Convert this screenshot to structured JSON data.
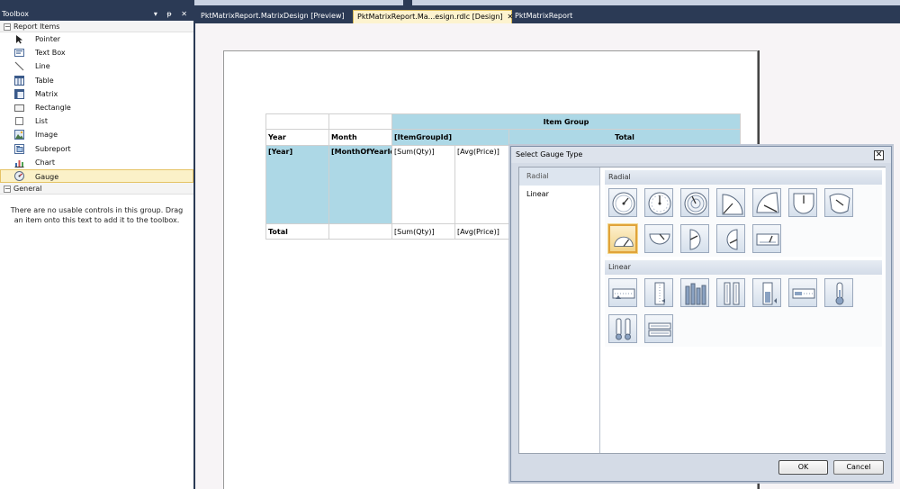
{
  "toolbox": {
    "title": "Toolbox",
    "controls": "▾ ᵽ ✕",
    "group_report_items": "Report Items",
    "items": [
      {
        "label": "Pointer",
        "icon": "pointer-icon"
      },
      {
        "label": "Text Box",
        "icon": "textbox-icon"
      },
      {
        "label": "Line",
        "icon": "line-icon"
      },
      {
        "label": "Table",
        "icon": "table-icon"
      },
      {
        "label": "Matrix",
        "icon": "matrix-icon"
      },
      {
        "label": "Rectangle",
        "icon": "rectangle-icon"
      },
      {
        "label": "List",
        "icon": "list-icon"
      },
      {
        "label": "Image",
        "icon": "image-icon"
      },
      {
        "label": "Subreport",
        "icon": "subreport-icon"
      },
      {
        "label": "Chart",
        "icon": "chart-icon"
      },
      {
        "label": "Gauge",
        "icon": "gauge-icon"
      }
    ],
    "group_general": "General",
    "empty_message": "There are no usable controls in this group. Drag an item onto this text to add it to the toolbox."
  },
  "tabs": [
    {
      "label": "PktMatrixReport.MatrixDesign [Preview]",
      "active": false
    },
    {
      "label": "PktMatrixReport.Ma...esign.rdlc [Design]",
      "active": true,
      "close": "✕"
    },
    {
      "label": "PktMatrixReport",
      "active": false
    }
  ],
  "matrix": {
    "item_group": "Item Group",
    "year_header": "Year",
    "month_header": "Month",
    "itemgroupid": "[ItemGroupId]",
    "total_header": "Total",
    "year_field": "[Year]",
    "month_field": "[MonthOfYearId",
    "sum_qty": "[Sum(Qty)]",
    "avg_price": "[Avg(Price)]",
    "total_row": "Total",
    "total_sum_qty": "[Sum(Qty)]",
    "total_avg_price": "[Avg(Price)]"
  },
  "dialog": {
    "title": "Select Gauge Type",
    "close": "✕",
    "nav": [
      {
        "label": "Radial",
        "selected": true
      },
      {
        "label": "Linear",
        "selected": false
      }
    ],
    "section_radial": "Radial",
    "section_linear": "Linear",
    "ok": "OK",
    "cancel": "Cancel"
  },
  "colors": {
    "chrome": "#2b3a55",
    "matrix_header": "#add8e6",
    "selection": "#fbf1c8"
  }
}
